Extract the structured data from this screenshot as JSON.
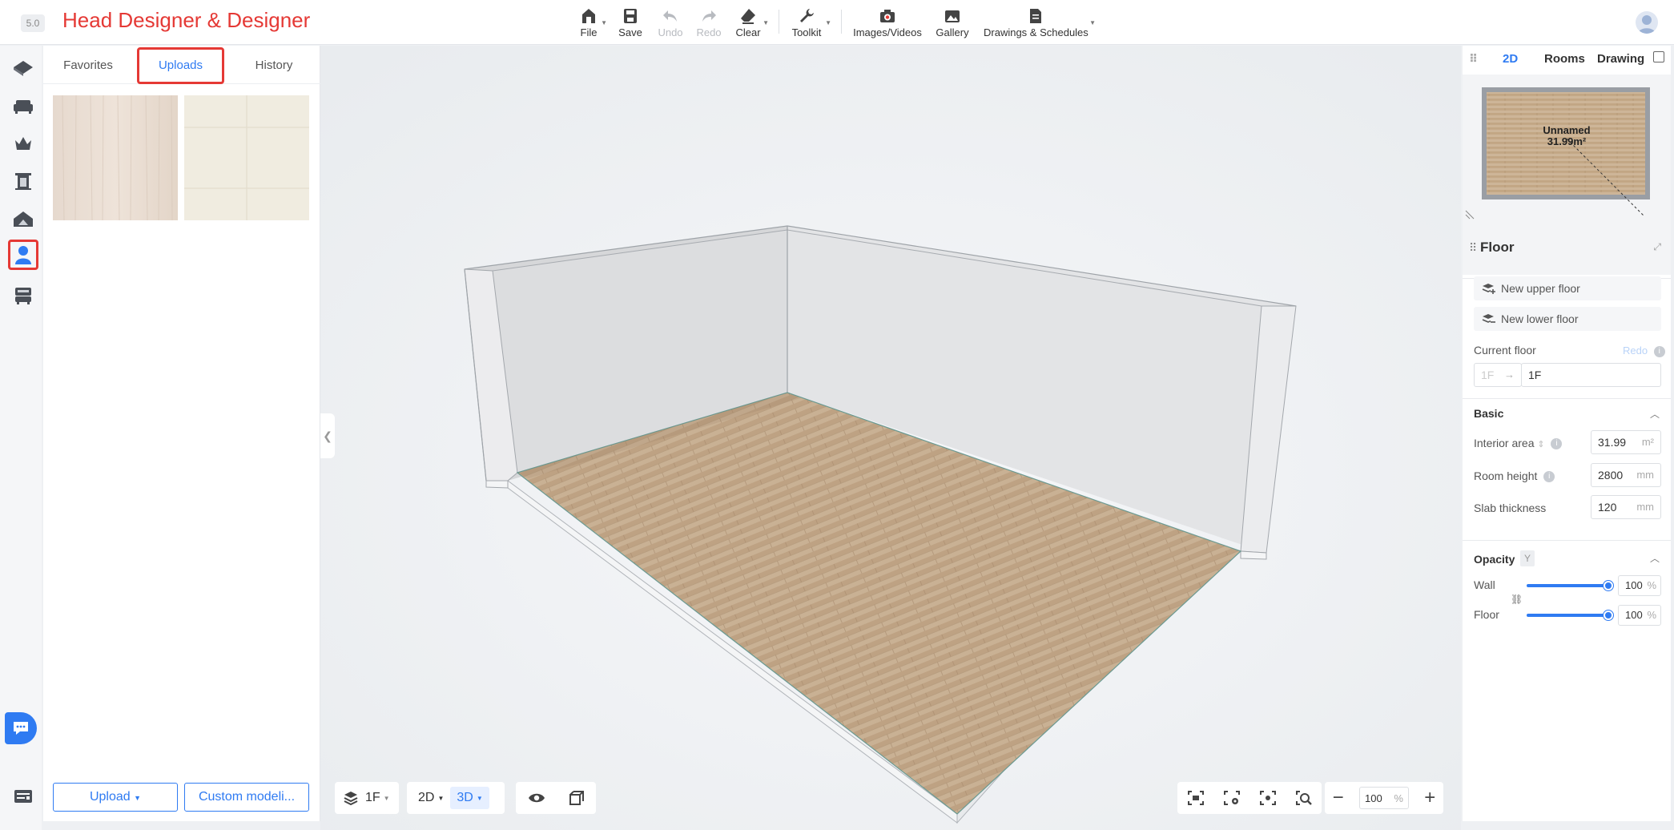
{
  "app": {
    "version": "5.0",
    "title": "Head Designer & Designer"
  },
  "toolbar": {
    "file": "File",
    "save": "Save",
    "undo": "Undo",
    "redo": "Redo",
    "clear": "Clear",
    "toolkit": "Toolkit",
    "images_videos": "Images/Videos",
    "gallery": "Gallery",
    "drawings": "Drawings & Schedules"
  },
  "library": {
    "tabs": [
      "Favorites",
      "Uploads",
      "History"
    ],
    "active_tab": "Uploads",
    "upload_button": "Upload",
    "custom_modeling_button": "Custom modeli..."
  },
  "canvas": {
    "floor_selector": "1F",
    "view_2d": "2D",
    "view_3d": "3D",
    "active_view": "3D",
    "zoom_value": "100",
    "zoom_unit": "%"
  },
  "right_panel": {
    "tabs": [
      "2D",
      "Rooms",
      "Drawing"
    ],
    "active_tab": "2D",
    "minimap": {
      "room_name": "Unnamed",
      "room_area": "31.99m²"
    },
    "floor_title": "Floor",
    "new_upper_floor": "New upper floor",
    "new_lower_floor": "New lower floor",
    "current_floor_label": "Current floor",
    "current_floor_redo": "Redo",
    "current_floor_code": "1F",
    "current_floor_name": "1F",
    "basic_title": "Basic",
    "interior_area_label": "Interior area",
    "interior_area_value": "31.99",
    "interior_area_unit": "m²",
    "room_height_label": "Room height",
    "room_height_value": "2800",
    "room_height_unit": "mm",
    "slab_thickness_label": "Slab thickness",
    "slab_thickness_value": "120",
    "slab_thickness_unit": "mm",
    "opacity_title": "Opacity",
    "opacity_shortcut": "Y",
    "wall_label": "Wall",
    "wall_opacity": "100",
    "floor_label": "Floor",
    "floor_opacity": "100",
    "percent_unit": "%"
  },
  "colors": {
    "accent": "#2f7bf2",
    "highlight": "#e53935",
    "title": "#e53935"
  }
}
